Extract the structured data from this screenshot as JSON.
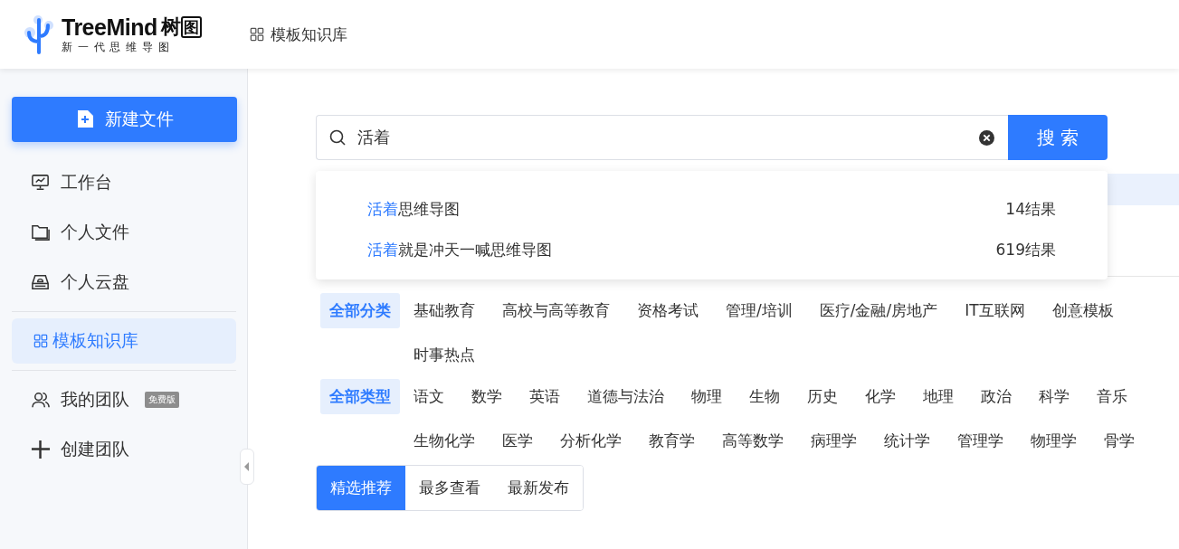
{
  "header": {
    "logo": {
      "name": "TreeMind",
      "name_cn": "树",
      "name_box": "图",
      "tagline": "新 一 代 思 维 导 图"
    },
    "nav_link": "模板知识库"
  },
  "sidebar": {
    "new_button": "新建文件",
    "items": [
      {
        "label": "工作台",
        "selected": false
      },
      {
        "label": "个人文件",
        "selected": false
      },
      {
        "label": "个人云盘",
        "selected": false
      },
      {
        "label": "模板知识库",
        "selected": true
      },
      {
        "label": "我的团队",
        "selected": false,
        "badge": "免费版"
      },
      {
        "label": "创建团队",
        "selected": false
      }
    ]
  },
  "search": {
    "value": "活着",
    "button": "搜 索",
    "suggestions": [
      {
        "match": "活着",
        "rest": "思维导图",
        "count": "14结果"
      },
      {
        "match": "活着",
        "rest": "就是冲天一喊思维导图",
        "count": "619结果"
      }
    ]
  },
  "filters": [
    {
      "all": {
        "label": "全部分类",
        "selected": true
      },
      "lines": [
        [
          "基础教育",
          "高校与高等教育",
          "资格考试",
          "管理/培训",
          "医疗/金融/房地产",
          "IT互联网",
          "创意模板"
        ],
        [
          "时事热点"
        ]
      ]
    },
    {
      "all": {
        "label": "全部类型",
        "selected": true
      },
      "lines": [
        [
          "语文",
          "数学",
          "英语",
          "道德与法治",
          "物理",
          "生物",
          "历史",
          "化学",
          "地理",
          "政治",
          "科学",
          "音乐"
        ],
        [
          "生物化学",
          "医学",
          "分析化学",
          "教育学",
          "高等数学",
          "病理学",
          "统计学",
          "管理学",
          "物理学",
          "骨学"
        ]
      ]
    }
  ],
  "sort_tabs": [
    {
      "label": "精选推荐",
      "selected": true
    },
    {
      "label": "最多查看",
      "selected": false
    },
    {
      "label": "最新发布",
      "selected": false
    }
  ]
}
